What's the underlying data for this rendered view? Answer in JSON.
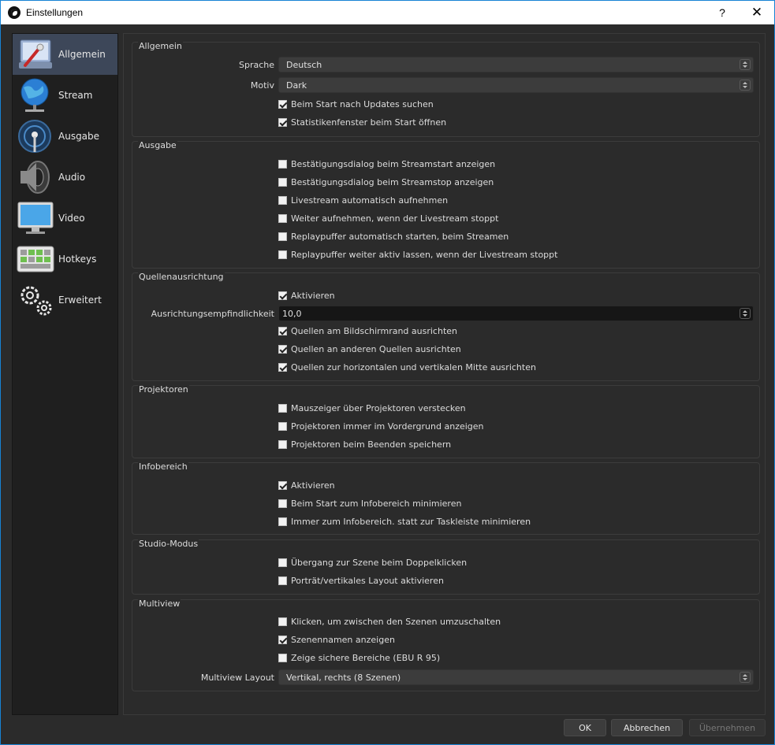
{
  "window": {
    "title": "Einstellungen",
    "help": "?",
    "close": "✕"
  },
  "sidebar": {
    "items": [
      {
        "label": "Allgemein",
        "icon": "settings-general-icon",
        "active": true
      },
      {
        "label": "Stream",
        "icon": "globe-network-icon"
      },
      {
        "label": "Ausgabe",
        "icon": "broadcast-antenna-icon"
      },
      {
        "label": "Audio",
        "icon": "speaker-icon"
      },
      {
        "label": "Video",
        "icon": "monitor-icon"
      },
      {
        "label": "Hotkeys",
        "icon": "keyboard-icon"
      },
      {
        "label": "Erweitert",
        "icon": "gears-icon"
      }
    ]
  },
  "groups": {
    "allgemein": {
      "title": "Allgemein",
      "sprache_label": "Sprache",
      "sprache_value": "Deutsch",
      "motiv_label": "Motiv",
      "motiv_value": "Dark",
      "c1": {
        "label": "Beim Start nach Updates suchen",
        "checked": true
      },
      "c2": {
        "label": "Statistikenfenster beim Start öffnen",
        "checked": true
      }
    },
    "ausgabe": {
      "title": "Ausgabe",
      "items": [
        {
          "label": "Bestätigungsdialog beim Streamstart anzeigen",
          "checked": false
        },
        {
          "label": "Bestätigungsdialog beim Streamstop anzeigen",
          "checked": false
        },
        {
          "label": "Livestream automatisch aufnehmen",
          "checked": false
        },
        {
          "label": "Weiter aufnehmen, wenn der Livestream stoppt",
          "checked": false
        },
        {
          "label": "Replaypuffer automatisch starten, beim Streamen",
          "checked": false
        },
        {
          "label": "Replaypuffer weiter aktiv lassen, wenn der Livestream stoppt",
          "checked": false
        }
      ]
    },
    "quellen": {
      "title": "Quellenausrichtung",
      "aktivieren": {
        "label": "Aktivieren",
        "checked": true
      },
      "empf_label": "Ausrichtungsempfindlichkeit",
      "empf_value": "10,0",
      "items": [
        {
          "label": "Quellen am Bildschirmrand ausrichten",
          "checked": true
        },
        {
          "label": "Quellen an anderen Quellen ausrichten",
          "checked": true
        },
        {
          "label": "Quellen zur horizontalen und vertikalen Mitte ausrichten",
          "checked": true
        }
      ]
    },
    "projektoren": {
      "title": "Projektoren",
      "items": [
        {
          "label": "Mauszeiger über Projektoren verstecken",
          "checked": false
        },
        {
          "label": "Projektoren immer im Vordergrund anzeigen",
          "checked": false
        },
        {
          "label": "Projektoren beim Beenden speichern",
          "checked": false
        }
      ]
    },
    "info": {
      "title": "Infobereich",
      "items": [
        {
          "label": "Aktivieren",
          "checked": true
        },
        {
          "label": "Beim Start zum Infobereich minimieren",
          "checked": false
        },
        {
          "label": "Immer zum Infobereich. statt zur Taskleiste minimieren",
          "checked": false
        }
      ]
    },
    "studio": {
      "title": "Studio-Modus",
      "items": [
        {
          "label": "Übergang zur Szene beim Doppelklicken",
          "checked": false
        },
        {
          "label": "Porträt/vertikales Layout aktivieren",
          "checked": false
        }
      ]
    },
    "multiview": {
      "title": "Multiview",
      "items": [
        {
          "label": "Klicken, um zwischen den Szenen umzuschalten",
          "checked": false
        },
        {
          "label": "Szenennamen anzeigen",
          "checked": true
        },
        {
          "label": "Zeige sichere Bereiche (EBU R 95)",
          "checked": false
        }
      ],
      "layout_label": "Multiview Layout",
      "layout_value": "Vertikal, rechts (8 Szenen)"
    }
  },
  "buttons": {
    "ok": "OK",
    "cancel": "Abbrechen",
    "apply": "Übernehmen"
  }
}
